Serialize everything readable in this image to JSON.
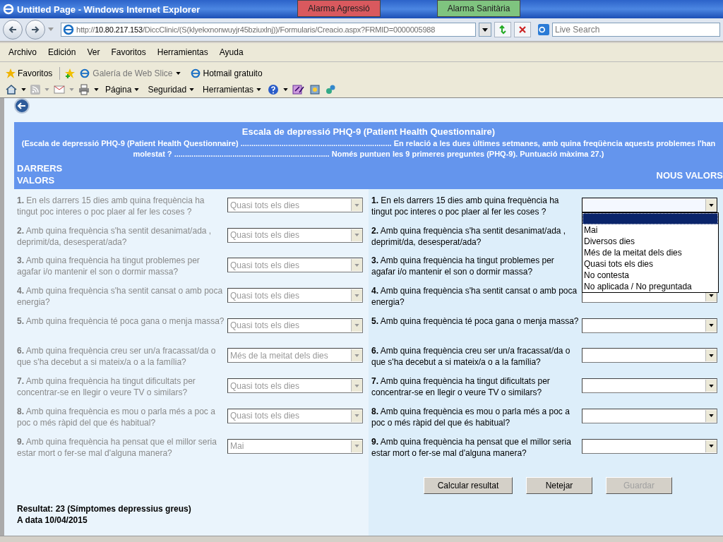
{
  "window": {
    "title": "Untitled Page - Windows Internet Explorer"
  },
  "alarms": [
    {
      "label": "Alarma Agressió",
      "color": "#d9595e"
    },
    {
      "label": "Alarma Sanitària",
      "color": "#7fc47f"
    }
  ],
  "address_bar": {
    "url": "http://**10.80.217.153**/DiccClinic/(S(klyekxnonwuyjr45bziuxlnj))/Formularis/Creacio.aspx?FRMID=0000005988",
    "search_placeholder": "Live Search"
  },
  "menu": [
    "Archivo",
    "Edición",
    "Ver",
    "Favoritos",
    "Herramientas",
    "Ayuda"
  ],
  "favorites_bar": {
    "label": "Favoritos",
    "links": [
      {
        "label": "Galería de Web Slice",
        "disabled": true,
        "has_menu": true
      },
      {
        "label": "Hotmail gratuito",
        "disabled": false,
        "has_menu": false
      }
    ]
  },
  "command_bar": [
    "Página",
    "Seguridad",
    "Herramientas"
  ],
  "form": {
    "title": "Escala de depressió PHQ-9 (Patient Health Questionnaire)",
    "description": "(Escala de depressió PHQ-9 (Patient Health Questionnaire) ...................................................................... En relació a les dues últimes setmanes, amb quina freqüència aquests problemes l'han molestat ? ........................................................................ Només puntuen les 9 primeres preguntes (PHQ-9). Puntuació màxima 27.)",
    "previous_heading": "DARRERS VALORS",
    "new_heading": "NOUS VALORS",
    "previous_values": [
      {
        "question": "**1.** En els darrers 15 dies amb quina frequència ha tingut poc interes o poc plaer al fer les coses ?",
        "value": "Quasi tots els dies",
        "disabled": true
      },
      {
        "question": "**2.** Amb quina frequència s'ha sentit desanimat/ada , deprimit/da, desesperat/ada?",
        "value": "Quasi tots els dies",
        "disabled": true
      },
      {
        "question": "**3.** Amb quina frequència ha tingut problemes per agafar i/o mantenir el son o dormir massa?",
        "value": "Quasi tots els dies",
        "disabled": true
      },
      {
        "question": "**4.** Amb quina frequència s'ha sentit cansat o amb poca energia?",
        "value": "Quasi tots els dies",
        "disabled": true
      },
      {
        "question": "**5.** Amb quina frequència té poca gana o menja massa?",
        "value": "Quasi tots els dies",
        "disabled": true
      },
      {
        "question": "**6.** Amb quina frequència creu ser un/a fracassat/da o que s'ha decebut a si mateix/a o a la família?",
        "value": "Més de la meitat dels dies",
        "disabled": true
      },
      {
        "question": "**7.** Amb quina frequència ha tingut dificultats per concentrar-se en llegir o veure TV o similars?",
        "value": "Quasi tots els dies",
        "disabled": true
      },
      {
        "question": "**8.** Amb quina frequència es mou o parla més a poc a poc o més ràpid del que és habitual?",
        "value": "Quasi tots els dies",
        "disabled": true
      },
      {
        "question": "**9.** Amb quina frequència ha pensat que el millor seria estar mort o fer-se mal d'alguna manera?",
        "value": "Mai",
        "disabled": true
      }
    ],
    "new_values": [
      {
        "question": "**1.** En els darrers 15 dies amb quina frequència ha tingut poc interes o poc plaer al fer les coses ?",
        "expanded": true
      },
      {
        "question": "**2.** Amb quina frequència s'ha sentit desanimat/ada , deprimit/da, desesperat/ada?",
        "expanded": false
      },
      {
        "question": "**3.** Amb quina frequència ha tingut problemes per agafar i/o mantenir el son o dormir massa?",
        "expanded": false
      },
      {
        "question": "**4.** Amb quina frequència s'ha sentit cansat o amb poca energia?",
        "expanded": false
      },
      {
        "question": "**5.** Amb quina frequència té poca gana o menja massa?",
        "expanded": false
      },
      {
        "question": "**6.** Amb quina frequència creu ser un/a fracassat/da o que s'ha decebut a si mateix/a o a la família?",
        "expanded": false
      },
      {
        "question": "**7.** Amb quina frequència ha tingut dificultats per concentrar-se en llegir o veure TV o similars?",
        "expanded": false
      },
      {
        "question": "**8.** Amb quina frequència es mou o parla més a poc a poc o més ràpid del que és habitual?",
        "expanded": false
      },
      {
        "question": "**9.** Amb quina frequència ha pensat que el millor seria estar mort o fer-se mal d'alguna manera?",
        "expanded": false
      }
    ],
    "dropdown_options": {
      "blank_selected": true,
      "options": [
        {
          "label": "Mai",
          "selected": false
        },
        {
          "label": "Diversos dies",
          "selected": false
        },
        {
          "label": "Més de la meitat dels dies",
          "selected": false
        },
        {
          "label": "Quasi tots els dies",
          "selected": false
        },
        {
          "label": "No contesta",
          "selected": false
        },
        {
          "label": "No aplicada / No preguntada",
          "selected": false
        }
      ]
    },
    "buttons": [
      {
        "label": "Calcular resultat",
        "disabled": false
      },
      {
        "label": "Netejar",
        "disabled": false
      },
      {
        "label": "Guardar",
        "disabled": true
      }
    ],
    "result": "Resultat: 23 (Símptomes depressius greus)",
    "result_date": "A data 10/04/2015"
  }
}
